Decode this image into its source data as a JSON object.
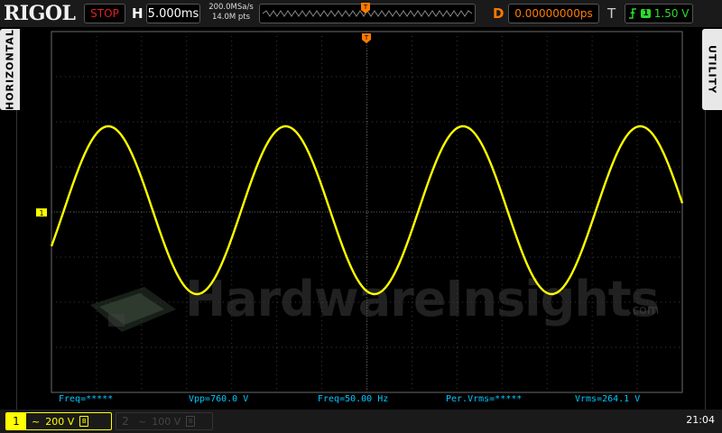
{
  "brand": "RIGOL",
  "status": "STOP",
  "timebase": {
    "label": "H",
    "value": "5.000ms"
  },
  "sample": {
    "rate": "200.0MSa/s",
    "points": "14.0M pts"
  },
  "delay": {
    "label": "D",
    "value": "0.00000000ps"
  },
  "trigger": {
    "label": "T",
    "source": "1",
    "level": "1.50 V",
    "slope_icon": "rising-edge-icon"
  },
  "side_tabs": {
    "left": "HORIZONTAL",
    "right": "UTILITY"
  },
  "measurements": [
    {
      "text": "Freq=*****"
    },
    {
      "text": "Vpp=760.0 V"
    },
    {
      "text": "Freq=50.00 Hz"
    },
    {
      "text": "Per.Vrms=*****"
    },
    {
      "text": "Vrms=264.1 V"
    }
  ],
  "channels": [
    {
      "num": "1",
      "coupling": "~",
      "scale": "200 V",
      "active": true
    },
    {
      "num": "2",
      "coupling": "~",
      "scale": "100 V",
      "active": false
    }
  ],
  "clock": "21:04",
  "watermark": {
    "text": "HardwareInsights",
    "suffix": ".com"
  },
  "ch1_marker": "1",
  "colors": {
    "ch1": "#ffff00",
    "accent": "#ff7a00",
    "trigger": "#2bdc2b",
    "measure": "#00c8ff",
    "status": "#e02020"
  }
}
